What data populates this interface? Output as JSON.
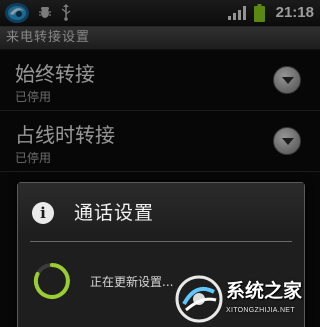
{
  "status_bar": {
    "time": "21:18",
    "icons": [
      "app-logo-icon",
      "bug-icon",
      "usb-icon",
      "signal-icon",
      "battery-icon"
    ]
  },
  "screen_title": "来电转接设置",
  "settings": [
    {
      "title": "始终转接",
      "subtitle": "已停用"
    },
    {
      "title": "占线时转接",
      "subtitle": "已停用"
    }
  ],
  "dialog": {
    "title": "通话设置",
    "message": "正在更新设置...",
    "icon": "info-icon"
  },
  "watermark": {
    "text": "系统之家",
    "url": "XITONGZHIJIA.NET"
  },
  "colors": {
    "battery": "#8ccf1e",
    "spinner": "#9acd32",
    "accent_app_icon": "#2aa3e0"
  }
}
